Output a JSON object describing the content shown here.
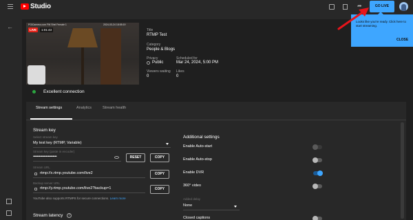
{
  "topbar": {
    "logo_text": "Studio",
    "go_live_label": "GO LIVE",
    "icons": [
      "menu-icon",
      "youtube-logo-icon",
      "video-icon",
      "bookmark-icon",
      "share-icon",
      "avatar"
    ]
  },
  "preview": {
    "live_badge": "LIVE",
    "live_time": "1:01:43",
    "overlay_text": "PGiCamera.com FW Shel Female 1",
    "overlay_date": "2024-03-24 18:55:19"
  },
  "stream_info": {
    "title_label": "Title",
    "title_value": "RTMP Test",
    "category_label": "Category",
    "category_value": "People & Blogs",
    "privacy_label": "Privacy",
    "privacy_value": "Public",
    "scheduled_label": "Scheduled for",
    "scheduled_value": "Mar 24, 2024, 5:00 PM",
    "viewers_label": "Viewers waiting",
    "viewers_value": "0",
    "likes_label": "Likes",
    "likes_value": "0"
  },
  "connection": {
    "status_text": "Excellent connection",
    "status_color": "#2ba640"
  },
  "tabs": [
    {
      "label": "Stream settings",
      "active": true
    },
    {
      "label": "Analytics",
      "active": false
    },
    {
      "label": "Stream health",
      "active": false
    }
  ],
  "stream_key": {
    "section_title": "Stream key",
    "select_label": "Select stream key",
    "select_value": "My test key (RTMP, Variable)",
    "key_label": "Stream key (paste in encoder)",
    "key_value": "••••••••••••••••••••••••",
    "reset_label": "RESET",
    "copy_label": "COPY",
    "url_label": "Stream URL",
    "url_value": "rtmp://x.rtmp.youtube.com/live2",
    "backup_label": "Backup server URL",
    "backup_value": "rtmp://y.rtmp.youtube.com/live2?backup=1",
    "help_text": "YouTube also supports RTMPS for secure connections.",
    "help_link": "Learn more"
  },
  "latency": {
    "section_title": "Stream latency"
  },
  "additional": {
    "section_title": "Additional settings",
    "items": [
      {
        "label": "Enable Auto-start",
        "on": false,
        "dim": true
      },
      {
        "label": "Enable Auto-stop",
        "on": false,
        "dim": false
      },
      {
        "label": "Enable DVR",
        "on": true,
        "dim": false
      },
      {
        "label": "360° video",
        "on": false,
        "dim": false
      }
    ],
    "delay_label": "Added delay",
    "delay_value": "None",
    "captions_label": "Closed captions",
    "captions_on": false
  },
  "popup": {
    "text": "Looks like you're ready. Click here to start streaming.",
    "close_label": "CLOSE"
  },
  "colors": {
    "accent": "#3ea6ff",
    "live_red": "#e62117",
    "annotation_red": "#e8141b"
  }
}
